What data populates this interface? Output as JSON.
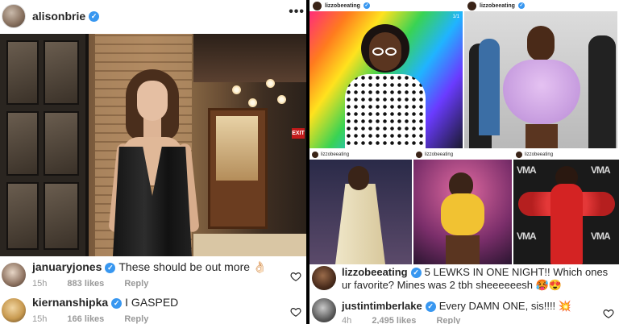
{
  "left_post": {
    "username": "alisonbrie",
    "verified_badge": "✓",
    "more_glyph": "•••",
    "photo": {
      "exit_sign": "EXIT"
    },
    "comments": [
      {
        "user": "januaryjones",
        "text": "These should be out more 👌🏻",
        "time": "15h",
        "likes": "883 likes",
        "reply": "Reply"
      },
      {
        "user": "kiernanshipka",
        "text": "I GASPED",
        "time": "15h",
        "likes": "166 likes",
        "reply": "Reply"
      }
    ]
  },
  "right_post": {
    "top_cells": [
      {
        "user": "lizzobeeating",
        "page_indicator": "1/1"
      },
      {
        "user": "lizzobeeating"
      }
    ],
    "bottom_cells": [
      {
        "user": "lizzobeeating"
      },
      {
        "user": "lizzobeeating"
      },
      {
        "user": "lizzobeeating",
        "stage_text": "VMA"
      }
    ],
    "comments": [
      {
        "user": "lizzobeeating",
        "text": "5 LEWKS IN ONE NIGHT!! Which ones ur favorite? Mines was 2 tbh sheeeeeesh 🥵😍"
      },
      {
        "user": "justintimberlake",
        "text": "Every DAMN ONE, sis!!!! 💥",
        "time": "4h",
        "likes": "2,495 likes",
        "reply": "Reply"
      }
    ]
  },
  "colors": {
    "verified": "#3897f0",
    "meta_gray": "#999999",
    "text": "#262626"
  },
  "icons": [
    "verified-badge-icon",
    "more-options-icon",
    "heart-icon"
  ]
}
